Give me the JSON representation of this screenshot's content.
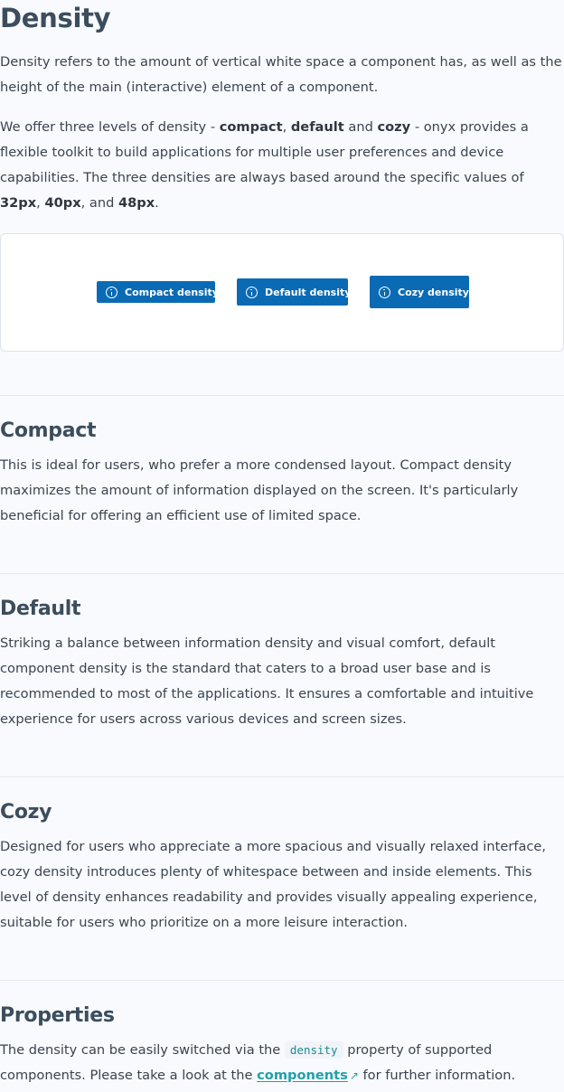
{
  "page": {
    "title": "Density",
    "intro_p1": "Density refers to the amount of vertical white space a component has, as well as the height of the main (interactive) element of a component.",
    "intro_p2": {
      "t1": "We offer three levels of density - ",
      "compact": "compact",
      "t2": ", ",
      "default": "default",
      "t3": " and ",
      "cozy": "cozy",
      "t4": " - onyx provides a flexible toolkit to build applications for multiple user preferences and device capabilities. The three densities are always based around the specific values of ",
      "v32": "32px",
      "t5": ", ",
      "v40": "40px",
      "t6": ", and ",
      "v48": "48px",
      "t7": "."
    }
  },
  "demo": {
    "buttons": [
      {
        "label": "Compact density",
        "icon": "info-icon"
      },
      {
        "label": "Default density",
        "icon": "info-icon"
      },
      {
        "label": "Cozy density",
        "icon": "info-icon"
      }
    ],
    "button_color": "#0a6bb4"
  },
  "sections": {
    "compact": {
      "title": "Compact",
      "body": "This is ideal for users, who prefer a more condensed layout. Compact density maximizes the amount of information displayed on the screen. It's particularly beneficial for offering an efficient use of limited space."
    },
    "default": {
      "title": "Default",
      "body": "Striking a balance between information density and visual comfort, default component density is the standard that caters to a broad user base and is recommended to most of the applications. It ensures a comfortable and intuitive experience for users across various devices and screen sizes."
    },
    "cozy": {
      "title": "Cozy",
      "body": "Designed for users who appreciate a more spacious and visually relaxed interface, cozy density introduces plenty of whitespace between and inside elements. This level of density enhances readability and provides visually appealing experience, suitable for users who prioritize on a more leisure interaction."
    },
    "properties": {
      "title": "Properties",
      "t1": "The density can be easily switched via the ",
      "code": "density",
      "t2": " property of supported components. Please take a look at the ",
      "link": "components",
      "link_icon": "external-link-icon",
      "t3": " for further information."
    }
  },
  "colors": {
    "heading": "#3c4d5c",
    "text": "#3c4451",
    "link": "#22a0a8",
    "background": "#f8fafd"
  }
}
